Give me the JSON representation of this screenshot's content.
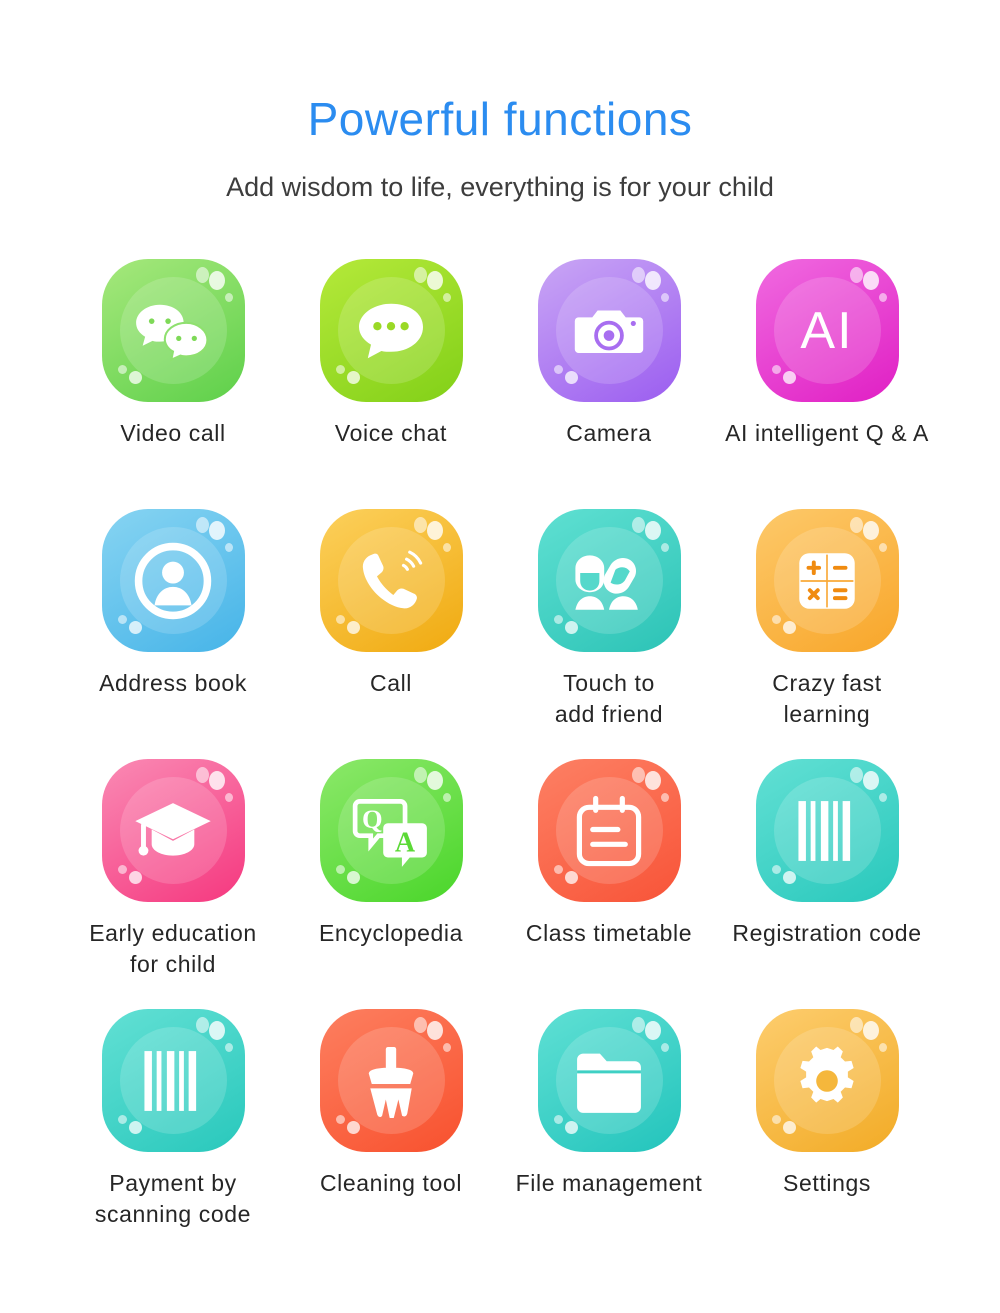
{
  "header": {
    "title": "Powerful functions",
    "subtitle": "Add wisdom to life, everything is for your child",
    "title_color": "#2b8cf0",
    "subtitle_color": "#3d3d3d"
  },
  "features": [
    {
      "label": "Video call",
      "icon": "chat-bubbles-icon",
      "color_start": "#a6e87c",
      "color_end": "#5ed04a"
    },
    {
      "label": "Voice chat",
      "icon": "speech-bubble-icon",
      "color_start": "#b5e93a",
      "color_end": "#82d018"
    },
    {
      "label": "Camera",
      "icon": "camera-icon",
      "color_start": "#c9a6f5",
      "color_end": "#9b5df0"
    },
    {
      "label": "AI intelligent Q & A",
      "icon": "ai-text-icon",
      "color_start": "#f06ae0",
      "color_end": "#e01fc4"
    },
    {
      "label": "Address book",
      "icon": "contact-person-icon",
      "color_start": "#87d4f2",
      "color_end": "#46b4e8"
    },
    {
      "label": "Call",
      "icon": "phone-handset-icon",
      "color_start": "#fcd05c",
      "color_end": "#f0aa10"
    },
    {
      "label": "Touch to\nadd friend",
      "icon": "two-people-icon",
      "color_start": "#5fe0d2",
      "color_end": "#2cc3b6"
    },
    {
      "label": "Crazy fast\nlearning",
      "icon": "calculator-icon",
      "color_start": "#fdc96a",
      "color_end": "#f8a62a"
    },
    {
      "label": "Early education\nfor child",
      "icon": "graduation-cap-icon",
      "color_start": "#fa8ab4",
      "color_end": "#f5387f"
    },
    {
      "label": "Encyclopedia",
      "icon": "qa-bubbles-icon",
      "color_start": "#8ce86a",
      "color_end": "#4ad62a"
    },
    {
      "label": "Class timetable",
      "icon": "calendar-notepad-icon",
      "color_start": "#fd8064",
      "color_end": "#f85438"
    },
    {
      "label": "Registration code",
      "icon": "barcode-icon",
      "color_start": "#62e0d4",
      "color_end": "#29c8bc"
    },
    {
      "label": "Payment by\nscanning code",
      "icon": "barcode-icon",
      "color_start": "#62e0d4",
      "color_end": "#29c8bc"
    },
    {
      "label": "Cleaning tool",
      "icon": "broom-icon",
      "color_start": "#fd7f60",
      "color_end": "#f8512e"
    },
    {
      "label": "File management",
      "icon": "folder-icon",
      "color_start": "#5fe0d4",
      "color_end": "#23c4bc"
    },
    {
      "label": "Settings",
      "icon": "gear-icon",
      "color_start": "#fdcd6e",
      "color_end": "#f2ab26"
    }
  ]
}
